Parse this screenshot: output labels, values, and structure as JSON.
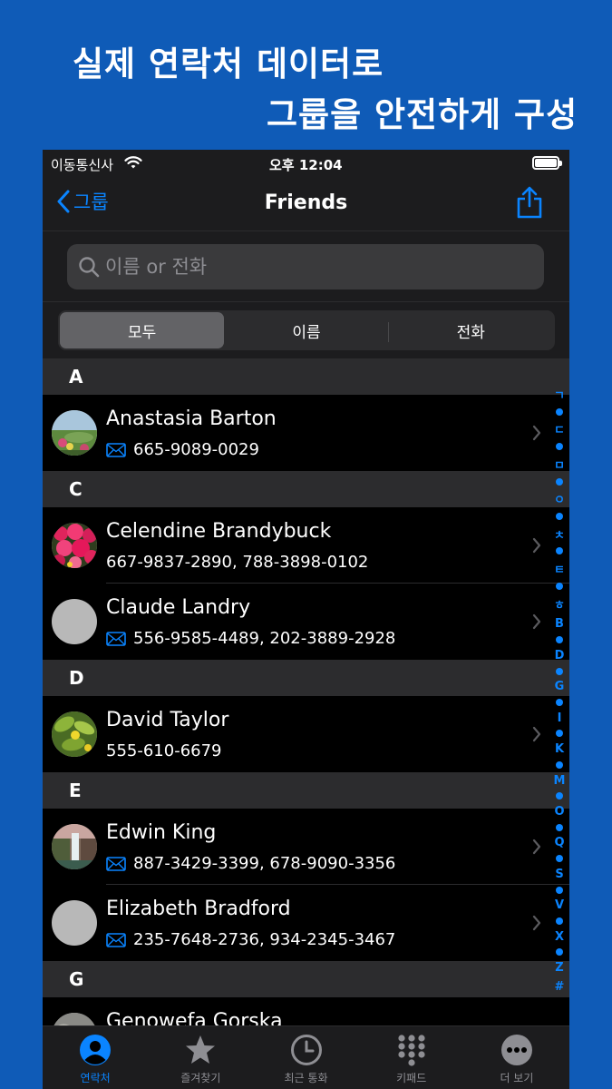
{
  "promo": {
    "line1": "실제 연락처 데이터로",
    "line2": "그룹을 안전하게 구성"
  },
  "statusbar": {
    "carrier": "이동통신사",
    "time": "오후 12:04"
  },
  "navbar": {
    "back_label": "그룹",
    "title": "Friends"
  },
  "search": {
    "placeholder": "이름 or 전화"
  },
  "segments": [
    "모두",
    "이름",
    "전화"
  ],
  "sections": [
    {
      "letter": "A",
      "contacts": [
        {
          "name": "Anastasia Barton",
          "detail": "665-9089-0029",
          "has_mail_icon": true
        }
      ]
    },
    {
      "letter": "C",
      "contacts": [
        {
          "name": "Celendine Brandybuck",
          "detail": "667-9837-2890, 788-3898-0102",
          "has_mail_icon": false
        },
        {
          "name": "Claude Landry",
          "detail": "556-9585-4489, 202-3889-2928",
          "has_mail_icon": true
        }
      ]
    },
    {
      "letter": "D",
      "contacts": [
        {
          "name": "David Taylor",
          "detail": "555-610-6679",
          "has_mail_icon": false
        }
      ]
    },
    {
      "letter": "E",
      "contacts": [
        {
          "name": "Edwin King",
          "detail": "887-3429-3399, 678-9090-3356",
          "has_mail_icon": true
        },
        {
          "name": "Elizabeth Bradford",
          "detail": "235-7648-2736, 934-2345-3467",
          "has_mail_icon": true
        }
      ]
    },
    {
      "letter": "G",
      "contacts": [
        {
          "name": "Genowefa Gorska",
          "detail": "",
          "has_mail_icon": false
        }
      ]
    }
  ],
  "index_letters": [
    "ㄱ",
    "ㄷ",
    "ㅁ",
    "ㅇ",
    "ㅊ",
    "ㅌ",
    "ㅎ",
    "B",
    "D",
    "G",
    "I",
    "K",
    "M",
    "O",
    "Q",
    "S",
    "V",
    "X",
    "Z",
    "#"
  ],
  "tabs": [
    {
      "label": "연락처",
      "icon": "person-icon",
      "active": true
    },
    {
      "label": "즐겨찾기",
      "icon": "star-icon",
      "active": false
    },
    {
      "label": "최근 통화",
      "icon": "clock-icon",
      "active": false
    },
    {
      "label": "키패드",
      "icon": "keypad-icon",
      "active": false
    },
    {
      "label": "더 보기",
      "icon": "more-icon",
      "active": false
    }
  ],
  "colors": {
    "background": "#0f5bb7",
    "accent": "#0a84ff",
    "bar": "#1c1c1e",
    "section": "#2c2c2e"
  }
}
